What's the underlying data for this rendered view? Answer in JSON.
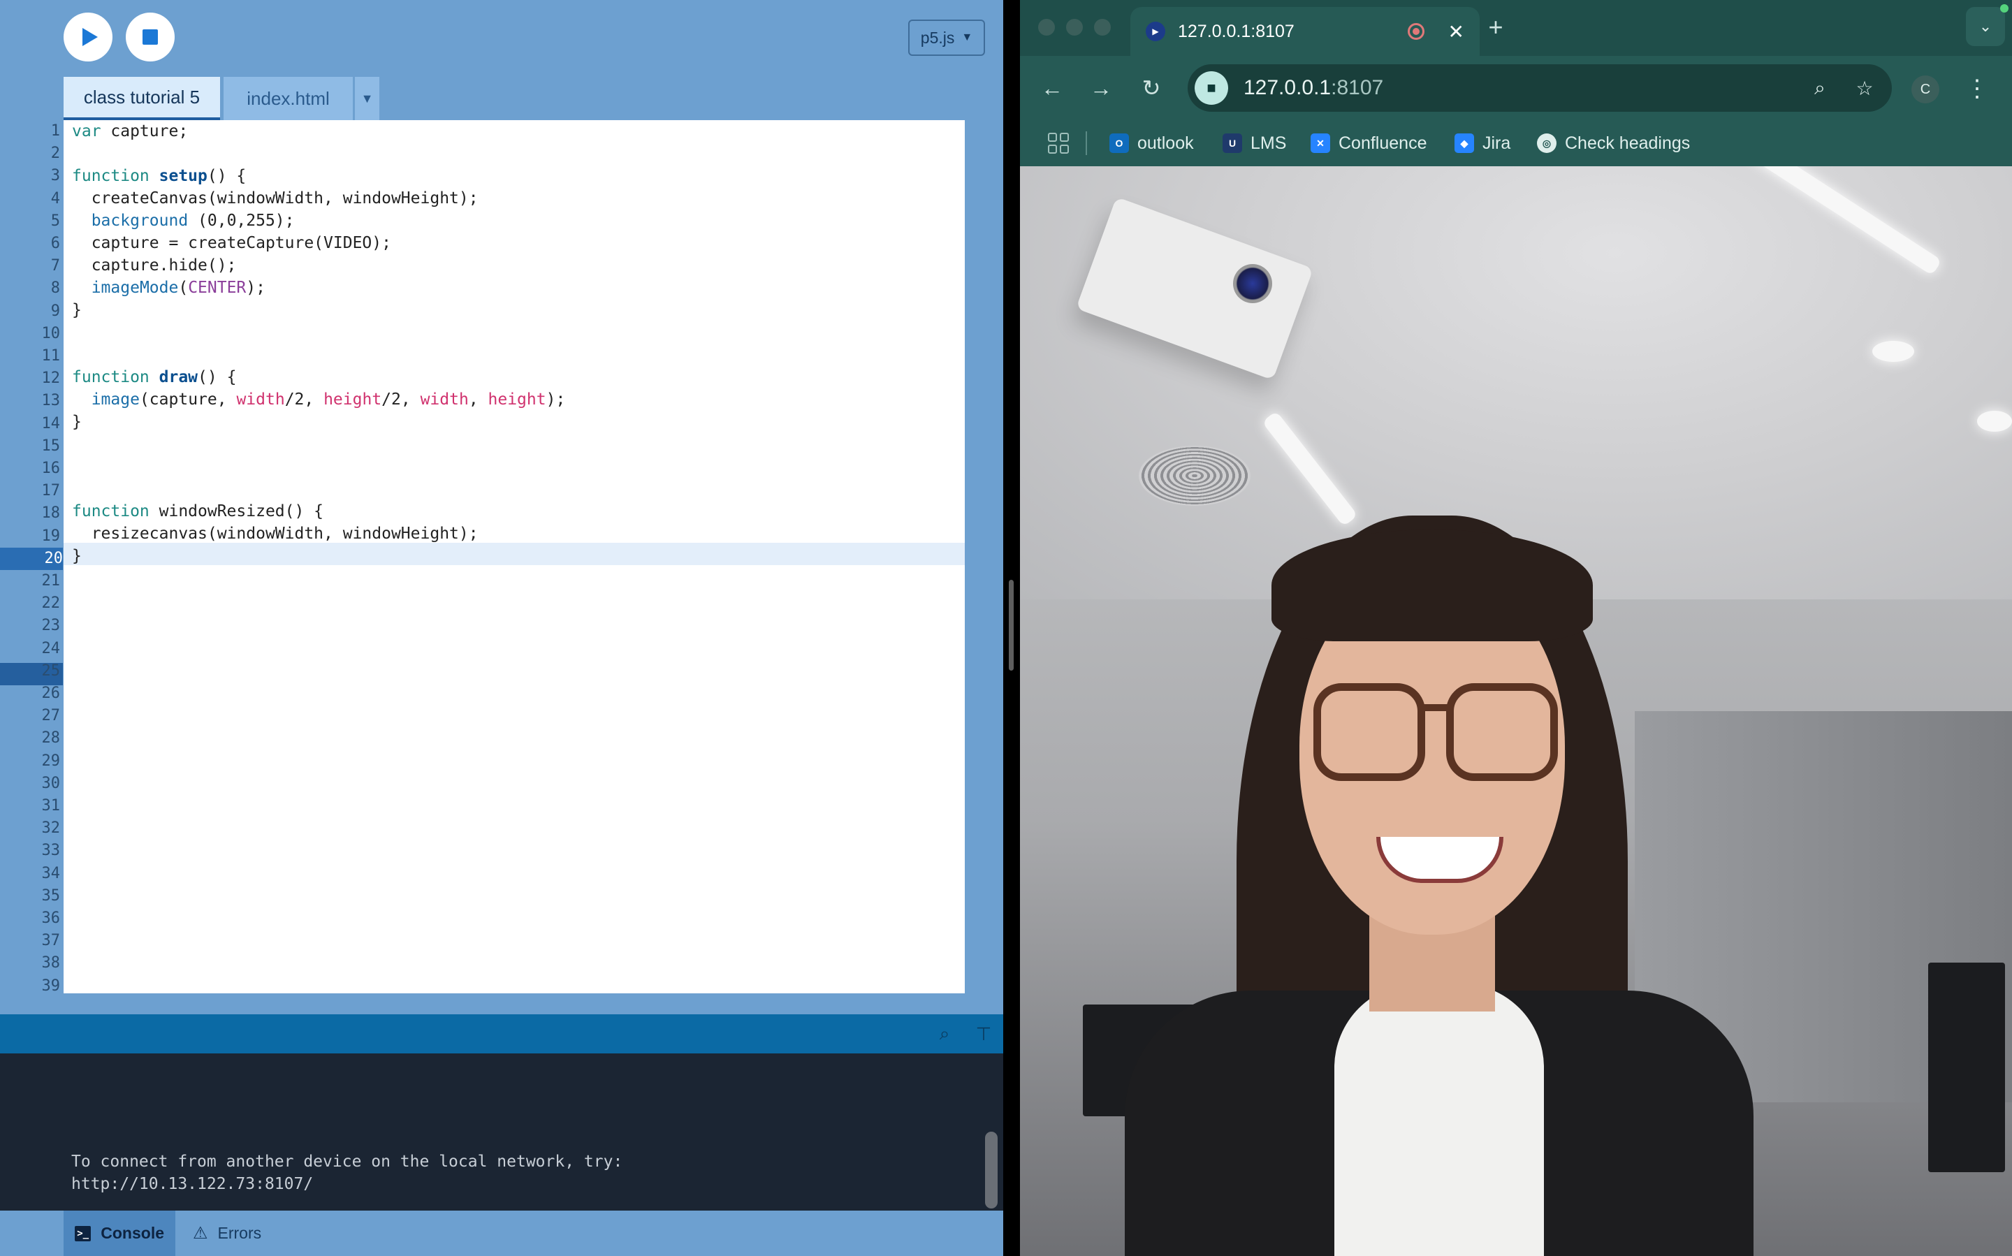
{
  "editor": {
    "run_label": "Run",
    "stop_label": "Stop",
    "mode": "p5.js",
    "tabs": [
      {
        "label": "class tutorial 5"
      },
      {
        "label": "index.html"
      }
    ],
    "line_numbers": [
      "1",
      "2",
      "3",
      "4",
      "5",
      "6",
      "7",
      "8",
      "9",
      "10",
      "11",
      "12",
      "13",
      "14",
      "15",
      "16",
      "17",
      "18",
      "19",
      "20",
      "21",
      "22",
      "23",
      "24",
      "25",
      "26",
      "27",
      "28",
      "29",
      "30",
      "31",
      "32",
      "33",
      "34",
      "35",
      "36",
      "37",
      "38",
      "39"
    ],
    "active_line": 20,
    "code_lines": [
      "var capture;",
      "",
      "function setup() {",
      "  createCanvas(windowWidth, windowHeight);",
      "  background (0,0,255);",
      "  capture = createCapture(VIDEO);",
      "  capture.hide();",
      "  imageMode(CENTER);",
      "}",
      "",
      "",
      "function draw() {",
      "  image(capture, width/2, height/2, width, height);",
      "}",
      "",
      "",
      "",
      "function windowResized() {",
      "  resizecanvas(windowWidth, windowHeight);",
      "}"
    ]
  },
  "console": {
    "lines": [
      "To connect from another device on the local network, try:",
      "http://10.13.122.73:8107/"
    ],
    "tabs": {
      "console": "Console",
      "errors": "Errors"
    },
    "terminal_glyph": ">_",
    "warn_glyph": "⚠"
  },
  "browser": {
    "tab_title": "127.0.0.1:8107",
    "tab_close": "✕",
    "new_tab": "+",
    "url_host": "127.0.0.1",
    "url_port": ":8107",
    "profile_initial": "C",
    "nav": {
      "back": "←",
      "forward": "→",
      "reload": "↻"
    },
    "bookmarks": [
      {
        "label": "outlook",
        "icon": "outlook-icon",
        "color": "#0f6cbd"
      },
      {
        "label": "LMS",
        "icon": "lms-icon",
        "color": "#1f3a6b"
      },
      {
        "label": "Confluence",
        "icon": "confluence-icon",
        "color": "#2684ff"
      },
      {
        "label": "Jira",
        "icon": "jira-icon",
        "color": "#2684ff"
      },
      {
        "label": "Check headings",
        "icon": "globe-icon",
        "color": "#dfefec"
      }
    ]
  },
  "colors": {
    "editor_bg": "#6da0d0",
    "accent": "#1b78d6",
    "browser_frame": "#265a55",
    "console_bg": "#1b2533"
  }
}
